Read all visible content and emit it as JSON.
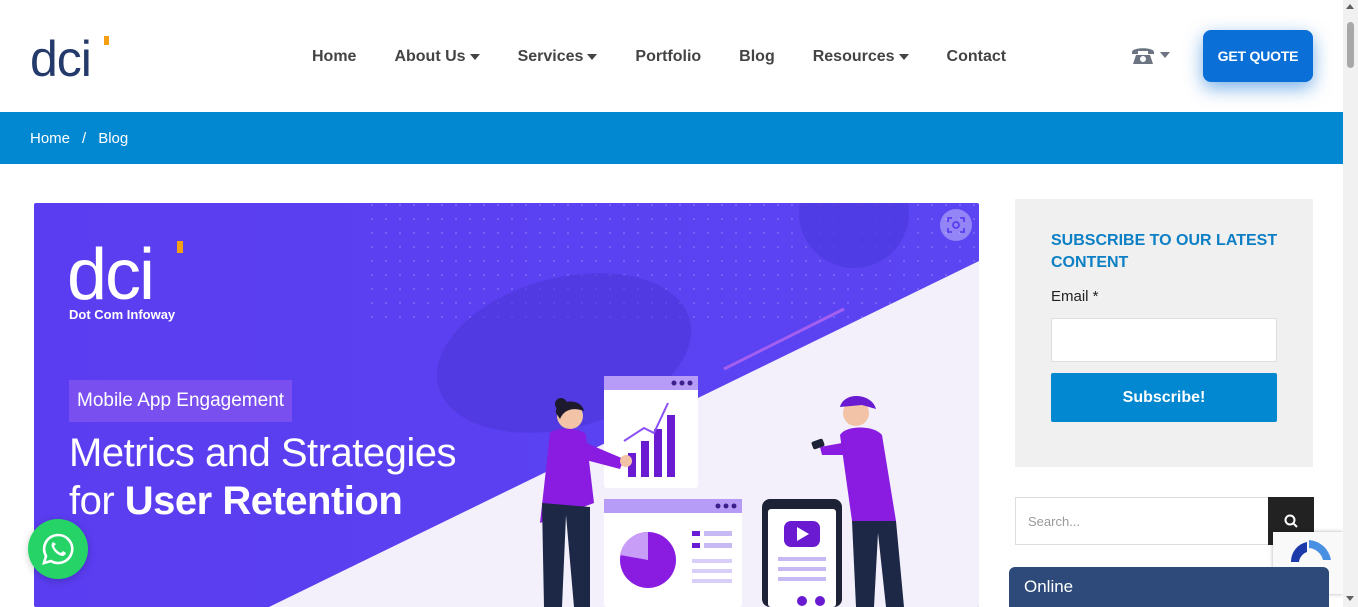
{
  "header": {
    "logo_text": "dci",
    "nav": [
      {
        "label": "Home",
        "dropdown": false
      },
      {
        "label": "About Us",
        "dropdown": true
      },
      {
        "label": "Services",
        "dropdown": true
      },
      {
        "label": "Portfolio",
        "dropdown": false
      },
      {
        "label": "Blog",
        "dropdown": false
      },
      {
        "label": "Resources",
        "dropdown": true
      },
      {
        "label": "Contact",
        "dropdown": false
      }
    ],
    "phone_icon": "telephone-icon",
    "quote_label": "GET QUOTE"
  },
  "breadcrumb": {
    "home": "Home",
    "separator": "/",
    "current": "Blog"
  },
  "hero": {
    "logo_text": "dci",
    "company": "Dot Com Infoway",
    "tag": "Mobile App Engagement",
    "title_line1": "Metrics and Strategies",
    "title_line2_plain": "for ",
    "title_line2_bold": "User Retention"
  },
  "sidebar": {
    "subscribe_title": "SUBSCRIBE TO OUR LATEST CONTENT",
    "email_label": "Email *",
    "subscribe_button": "Subscribe!",
    "search_placeholder": "Search..."
  },
  "chat": {
    "status": "Online"
  },
  "colors": {
    "primary_blue": "#0288d1",
    "quote_blue": "#0a6fd6",
    "hero_purple": "#5b3ff0",
    "chat_navy": "#2d4a7a",
    "whatsapp_green": "#25d366"
  }
}
